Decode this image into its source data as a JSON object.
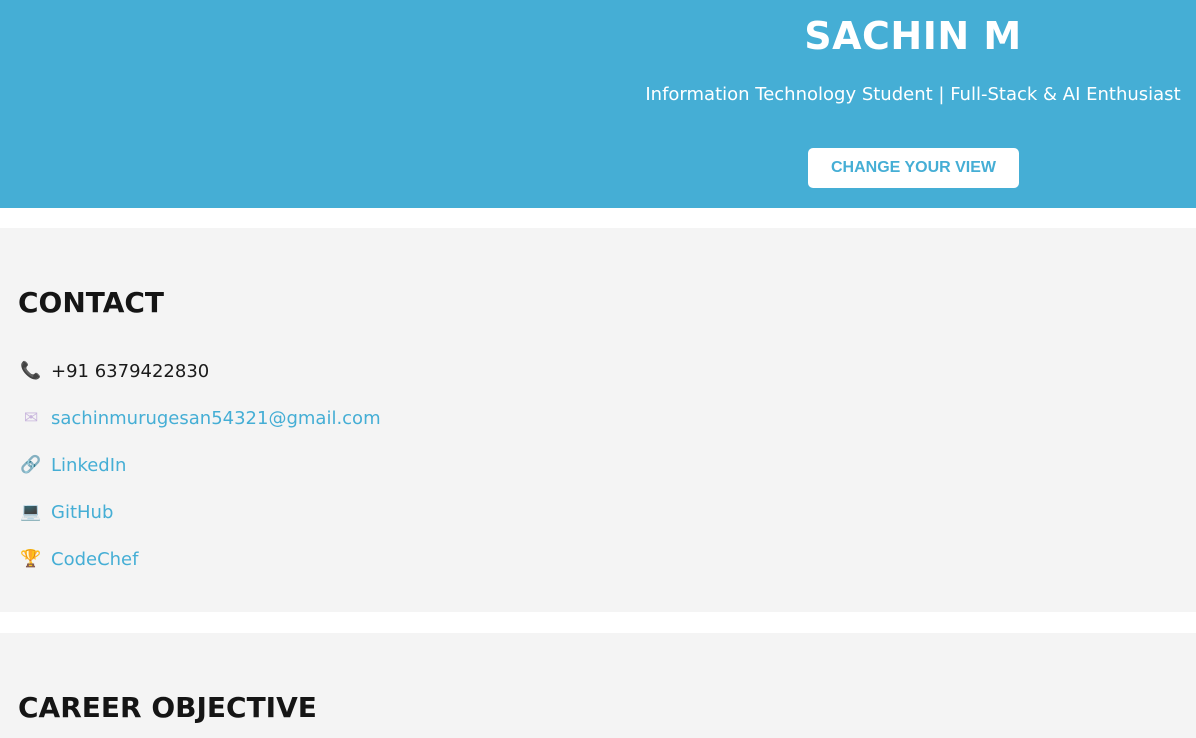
{
  "header": {
    "name": "SACHIN M",
    "subtitle": "Information Technology Student | Full-Stack & AI Enthusiast",
    "view_button": "CHANGE YOUR VIEW"
  },
  "contact": {
    "title": "CONTACT",
    "items": [
      {
        "icon": "phone-icon",
        "text": "+91 6379422830"
      },
      {
        "icon": "mail-icon",
        "text": "sachinmurugesan54321@gmail.com"
      },
      {
        "icon": "link-icon",
        "text": "LinkedIn"
      },
      {
        "icon": "laptop-icon",
        "text": "GitHub"
      },
      {
        "icon": "trophy-icon",
        "text": "CodeChef"
      }
    ]
  },
  "career": {
    "title": "CAREER OBJECTIVE"
  },
  "colors": {
    "header_bg": "#45aed5",
    "link": "#45aed5",
    "section_bg": "#f4f4f4"
  }
}
